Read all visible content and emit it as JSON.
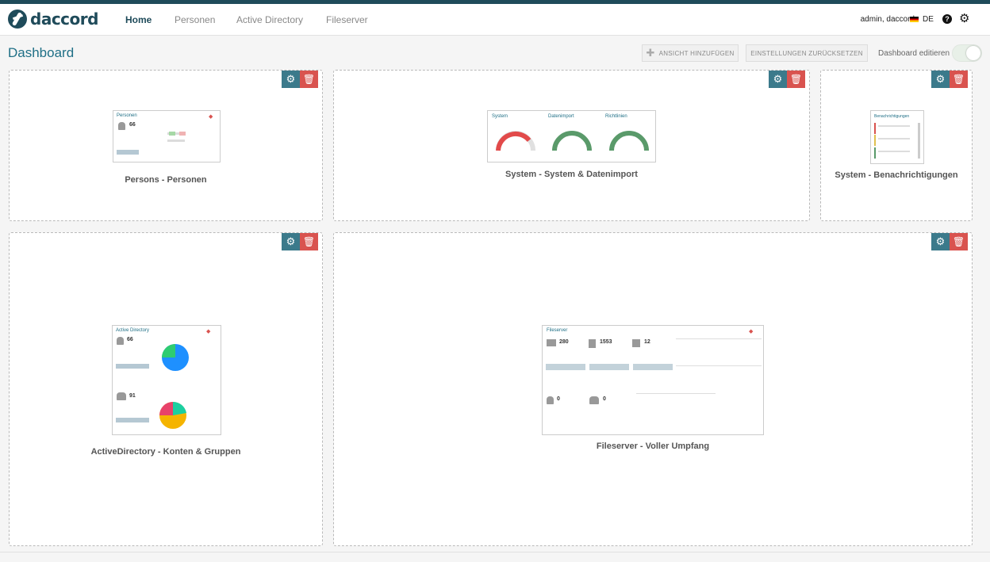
{
  "app": {
    "logo_text": "daccord",
    "user": "admin, daccord",
    "language": "DE"
  },
  "nav": {
    "items": [
      {
        "label": "Home"
      },
      {
        "label": "Personen"
      },
      {
        "label": "Active Directory"
      },
      {
        "label": "Fileserver"
      }
    ]
  },
  "page": {
    "title": "Dashboard"
  },
  "toolbar": {
    "add_view": "ANSICHT HINZUFÜGEN",
    "reset_settings": "EINSTELLUNGEN ZURÜCKSETZEN",
    "edit_dashboard": "Dashboard editieren",
    "edit_enabled": false
  },
  "panels": [
    {
      "title": "Persons - Personen",
      "thumb": {
        "heading": "Personen",
        "count": "66"
      }
    },
    {
      "title": "System - System & Datenimport",
      "thumb": {
        "sections": [
          "System",
          "Datenimport",
          "Richtlinien"
        ]
      }
    },
    {
      "title": "System - Benachrichtigungen",
      "thumb": {
        "heading": "Benachrichtigungen"
      }
    },
    {
      "title": "ActiveDirectory - Konten & Gruppen",
      "thumb": {
        "heading": "Active Directory",
        "accounts": "66",
        "groups": "91"
      }
    },
    {
      "title": "Fileserver - Voller Umpfang",
      "thumb": {
        "heading": "Fileserver",
        "values": [
          "280",
          "1553",
          "12",
          "0",
          "0"
        ]
      }
    }
  ],
  "colors": {
    "brand": "#1f4b5a",
    "accent": "#1f6f86",
    "gear_button": "#3b7a8b",
    "delete_button": "#d9534f"
  }
}
